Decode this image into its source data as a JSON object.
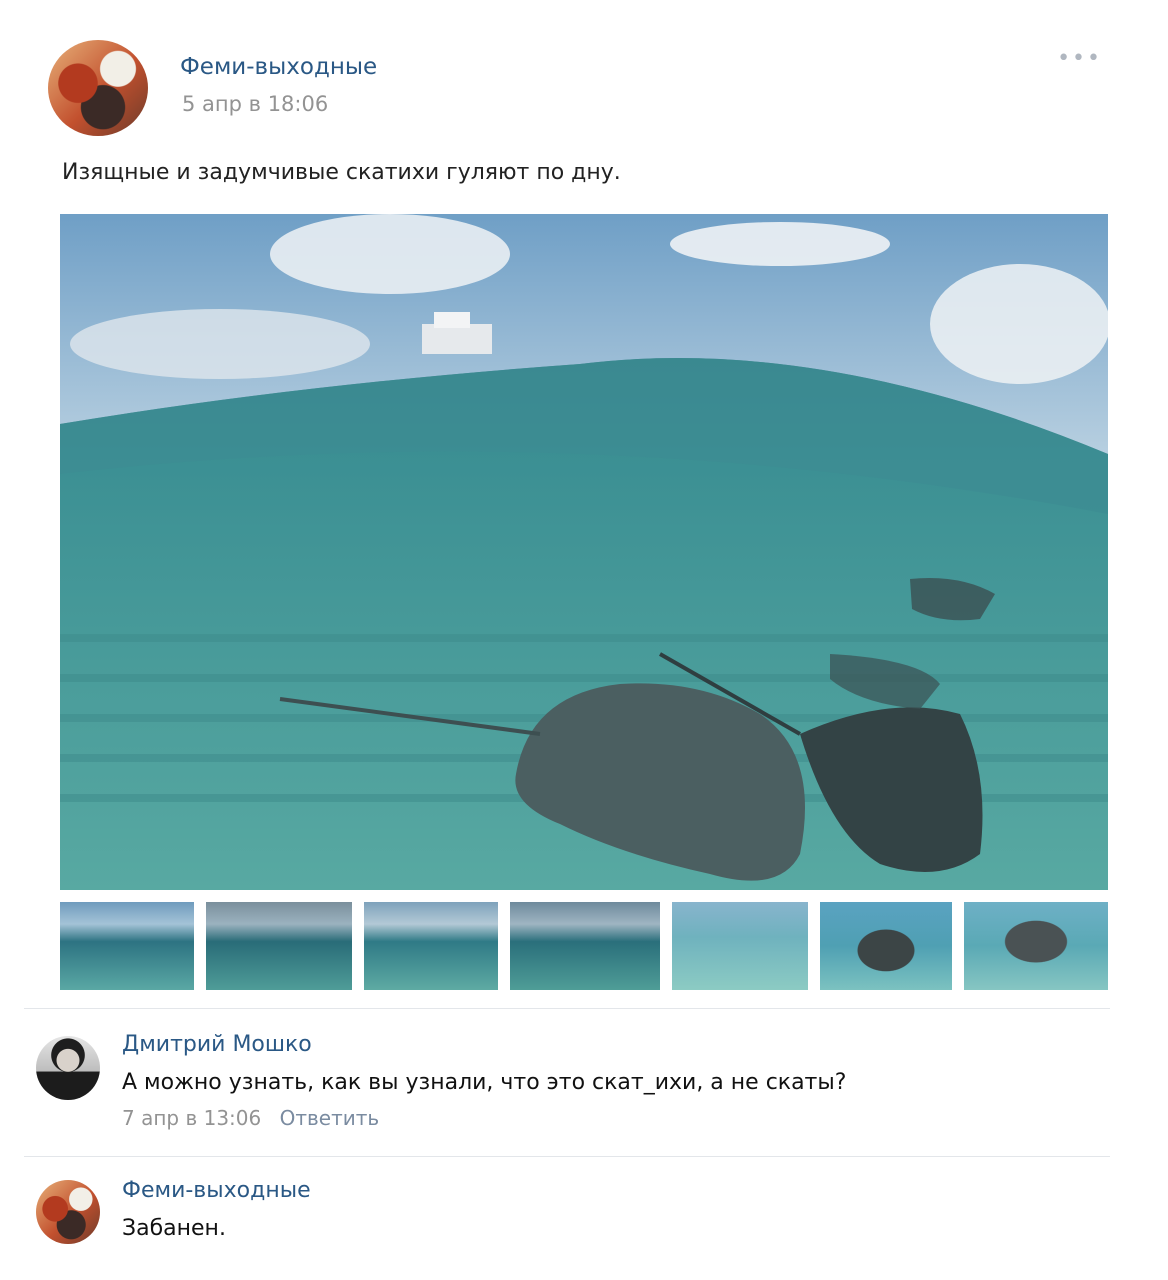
{
  "post": {
    "author": "Феми-выходные",
    "date": "5 апр в 18:06",
    "text": "Изящные и задумчивые скатихи гуляют по дну.",
    "menu_icon": "more-dots-icon"
  },
  "comments": [
    {
      "author": "Дмитрий Мошко",
      "text": "А можно узнать, как вы узнали, что это скат_ихи, а не скаты?",
      "date": "7 апр в 13:06",
      "reply_label": "Ответить"
    },
    {
      "author": "Феми-выходные",
      "text": "Забанен."
    }
  ]
}
